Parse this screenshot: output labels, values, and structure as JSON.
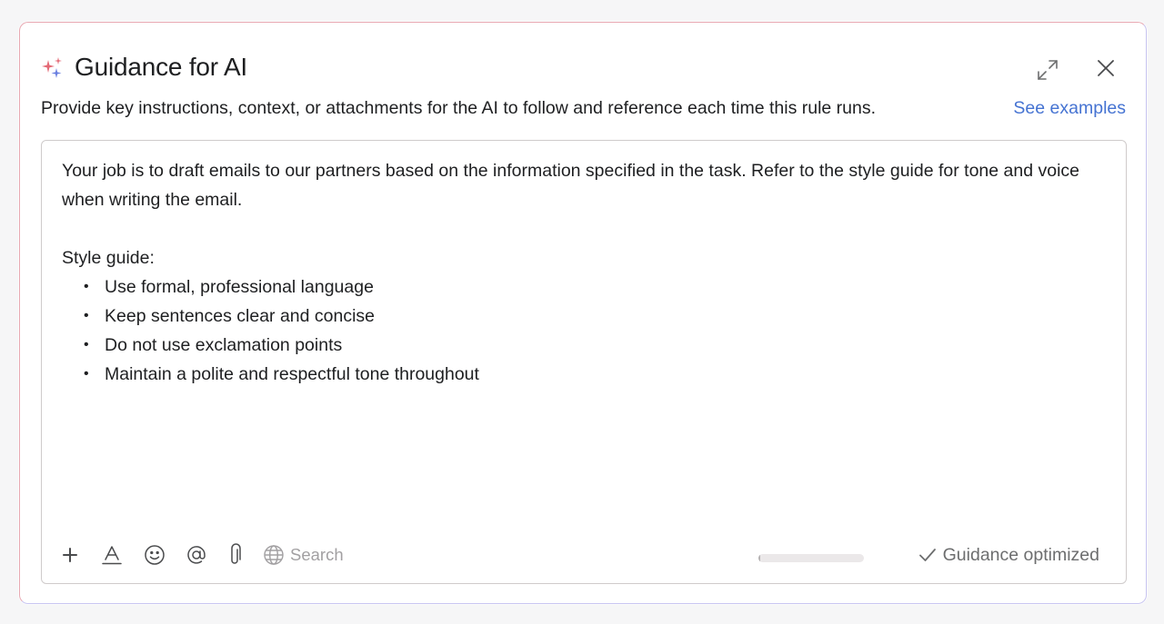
{
  "dialog": {
    "title": "Guidance for AI",
    "description": "Provide key instructions, context, or attachments for the AI to follow and reference each time this rule runs.",
    "see_examples_label": "See examples",
    "icons": {
      "title": "sparkle-icon",
      "expand": "expand-icon",
      "close": "close-icon"
    },
    "colors": {
      "accent_link": "#4573d2",
      "sparkle_pink": "#e46a76",
      "sparkle_blue": "#6a7fe0",
      "border_pink": "#e8a9b2",
      "border_violet": "#c7c3f0"
    }
  },
  "editor": {
    "intro": "Your job is to draft emails to our partners based on the information specified in the task. Refer to the style guide for tone and voice when writing the email.",
    "style_heading": "Style guide:",
    "bullets": [
      "Use formal, professional language",
      "Keep sentences clear and concise",
      "Do not use exclamation points",
      "Maintain a polite and respectful tone throughout"
    ]
  },
  "toolbar": {
    "tools": [
      "plus-icon",
      "text-format-icon",
      "emoji-icon",
      "mention-icon",
      "attachment-icon",
      "globe-icon"
    ],
    "search_label": "Search",
    "progress_fraction": 0.02,
    "status_label": "Guidance optimized",
    "status_icon": "check-icon"
  }
}
